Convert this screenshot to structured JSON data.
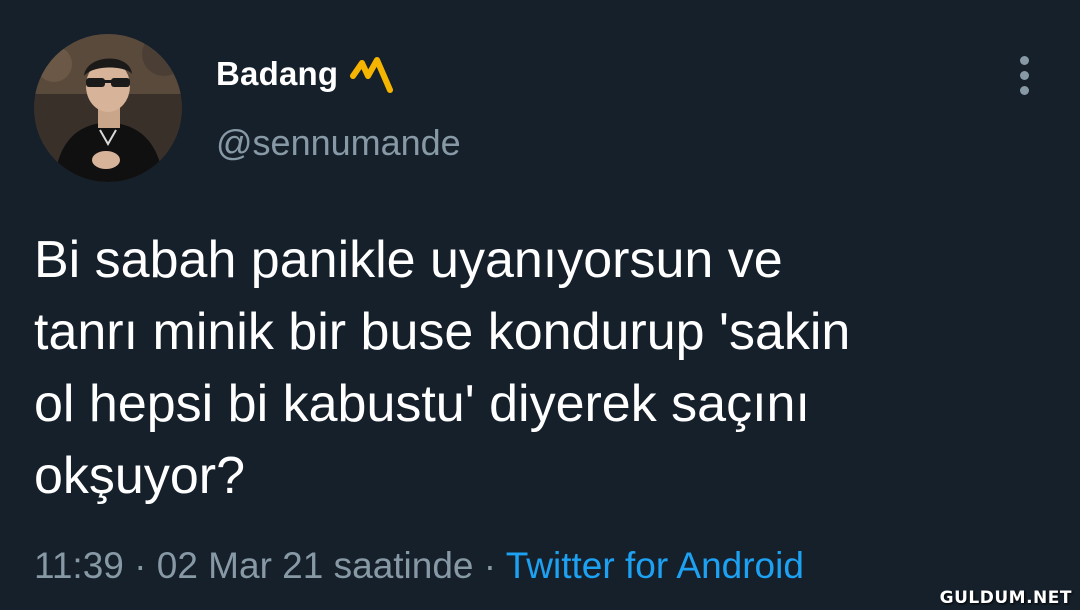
{
  "author": {
    "display_name": "Badang",
    "handle": "@sennumande",
    "name_emoji_icon": "zigzag-emoji-icon"
  },
  "menu": {
    "icon": "vertical-ellipsis-icon"
  },
  "tweet": {
    "text": "Bi sabah panikle uyanıyorsun ve\ntanrı minik bir buse kondurup 'sakin\nol hepsi bi kabustu' diyerek saçını\nokşuyor?"
  },
  "meta": {
    "time": "11:39",
    "separator_1": " · ",
    "date": "02 Mar 21",
    "suffix": " saatinde",
    "separator_2": " · ",
    "source": "Twitter for Android"
  },
  "watermark": {
    "text": "GULDUM.NET"
  },
  "colors": {
    "background": "#15202b",
    "primary_text": "#ffffff",
    "secondary_text": "#8899a6",
    "link": "#1da1f2",
    "emoji": "#f5b400"
  }
}
